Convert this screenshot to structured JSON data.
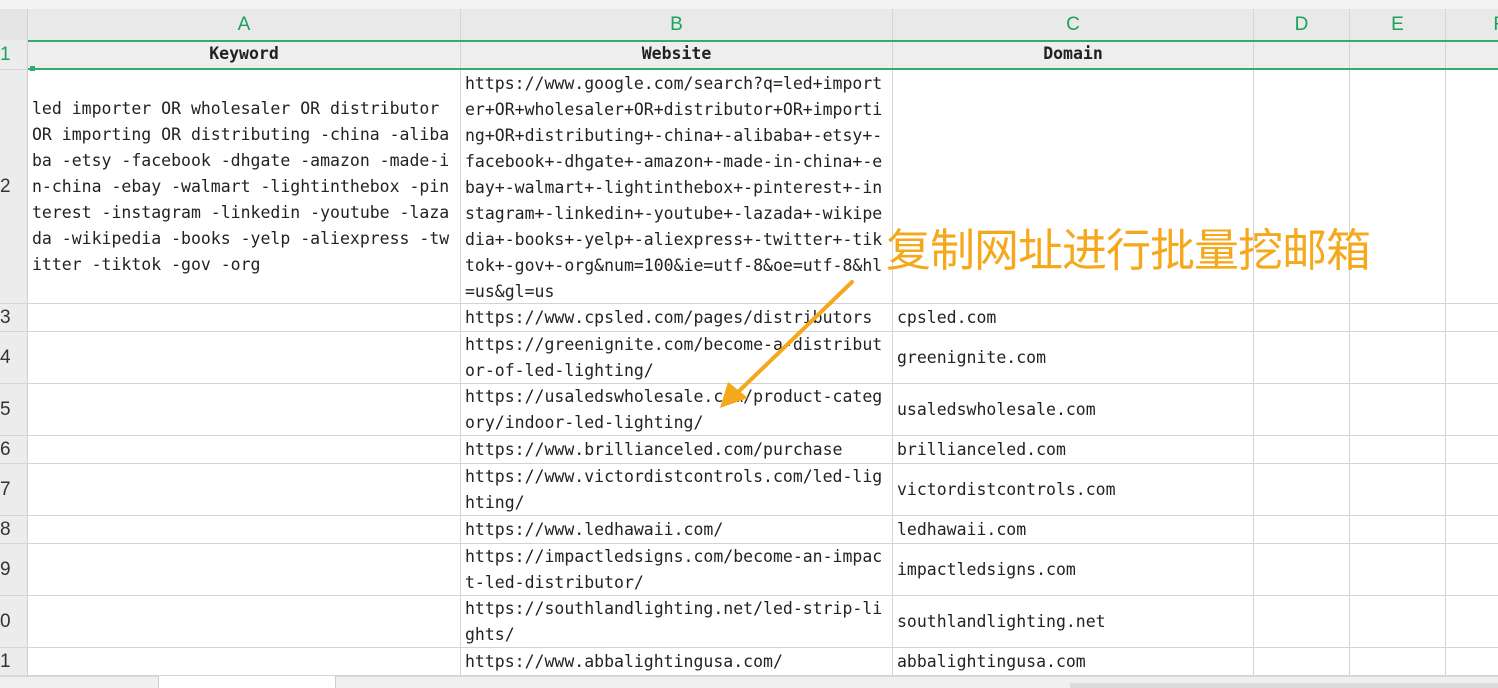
{
  "columns": [
    "A",
    "B",
    "C",
    "D",
    "E",
    "F"
  ],
  "rows": [
    "1",
    "2",
    "3",
    "4",
    "5",
    "6",
    "7",
    "8",
    "9",
    "0",
    "1"
  ],
  "headers": {
    "keyword": "Keyword",
    "website": "Website",
    "domain": "Domain"
  },
  "keyword": "led importer OR wholesaler OR distributor OR importing OR distributing -china -alibaba -etsy -facebook -dhgate -amazon -made-in-china -ebay -walmart -lightinthebox -pinterest -instagram -linkedin -youtube -lazada -wikipedia -books -yelp -aliexpress -twitter -tiktok -gov -org",
  "search_url": "https://www.google.com/search?q=led+importer+OR+wholesaler+OR+distributor+OR+importing+OR+distributing+-china+-alibaba+-etsy+-facebook+-dhgate+-amazon+-made-in-china+-ebay+-walmart+-lightinthebox+-pinterest+-instagram+-linkedin+-youtube+-lazada+-wikipedia+-books+-yelp+-aliexpress+-twitter+-tiktok+-gov+-org&num=100&ie=utf-8&oe=utf-8&hl=us&gl=us",
  "results": [
    {
      "website": "https://www.cpsled.com/pages/distributors",
      "domain": "cpsled.com"
    },
    {
      "website": "https://greenignite.com/become-a-distributor-of-led-lighting/",
      "domain": "greenignite.com"
    },
    {
      "website": "https://usaledswholesale.com/product-category/indoor-led-lighting/",
      "domain": "usaledswholesale.com"
    },
    {
      "website": "https://www.brillianceled.com/purchase",
      "domain": "brillianceled.com"
    },
    {
      "website": "https://www.victordistcontrols.com/led-lighting/",
      "domain": "victordistcontrols.com"
    },
    {
      "website": "https://www.ledhawaii.com/",
      "domain": "ledhawaii.com"
    },
    {
      "website": "https://impactledsigns.com/become-an-impact-led-distributor/",
      "domain": "impactledsigns.com"
    },
    {
      "website": "https://southlandlighting.net/led-strip-lights/",
      "domain": "southlandlighting.net"
    },
    {
      "website": "https://www.abbalightingusa.com/",
      "domain": "abbalightingusa.com"
    }
  ],
  "annotation": "复制网址进行批量挖邮箱",
  "colors": {
    "accent_green": "#2fae6b",
    "annotation_orange": "#f5a81c"
  }
}
